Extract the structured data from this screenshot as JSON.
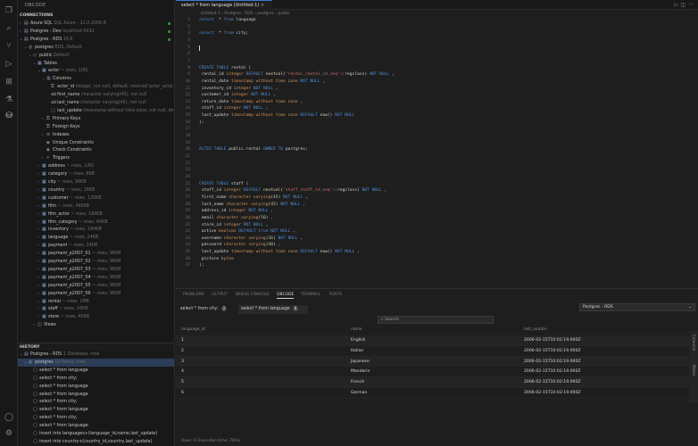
{
  "sidebar": {
    "header": "DBCODE",
    "connections_title": "CONNECTIONS",
    "tree": [
      {
        "chev": "›",
        "icon": "▤",
        "label": "Azure SQL",
        "dim": "SQL Azure - 12.0.2000.8",
        "level": 1,
        "dot": true
      },
      {
        "chev": "›",
        "icon": "▤",
        "label": "Postgres - Dev",
        "dim": "localhost:5432",
        "level": 1,
        "dot": true
      },
      {
        "chev": "⌄",
        "icon": "▤",
        "label": "Postgres - RDS",
        "dim": "16.6",
        "level": 1,
        "dot": true
      },
      {
        "chev": "⌄",
        "icon": "◎",
        "label": "postgres",
        "dim": "RDS, Default",
        "level": 2
      },
      {
        "chev": "⌄",
        "icon": "◇",
        "label": "public",
        "dim": "Default",
        "level": 3
      },
      {
        "chev": "⌄",
        "icon": "▦",
        "label": "Tables",
        "dim": "",
        "level": 4
      },
      {
        "chev": "⌄",
        "icon": "▦",
        "label": "actor",
        "dim": "~ rows, 1/6S",
        "level": 5
      },
      {
        "chev": "⌄",
        "icon": "▥",
        "label": "Columns",
        "dim": "",
        "level": 6
      },
      {
        "chev": "",
        "icon": "⚿",
        "label": "actor_id",
        "dim": "integer, not null, default: nextval('actor_actor_id_seq'::regclass)",
        "level": 7
      },
      {
        "chev": "",
        "icon": "ab",
        "label": "first_name",
        "dim": "character varying(45), not null",
        "level": 7
      },
      {
        "chev": "",
        "icon": "ab",
        "label": "last_name",
        "dim": "character varying(45), not null",
        "level": 7
      },
      {
        "chev": "",
        "icon": "▢",
        "label": "last_update",
        "dim": "timestamp without time zone, not null, default: now()",
        "level": 7
      },
      {
        "chev": "›",
        "icon": "⚿",
        "label": "Primary Keys",
        "dim": "",
        "level": 6
      },
      {
        "chev": "",
        "icon": "⚿",
        "label": "Foreign Keys",
        "dim": "",
        "level": 6
      },
      {
        "chev": "›",
        "icon": "≡",
        "label": "Indexes",
        "dim": "",
        "level": 6
      },
      {
        "chev": "",
        "icon": "◈",
        "label": "Unique Constraints",
        "dim": "",
        "level": 6
      },
      {
        "chev": "",
        "icon": "◈",
        "label": "Check Constraints",
        "dim": "",
        "level": 6
      },
      {
        "chev": "›",
        "icon": "⚡",
        "label": "Triggers",
        "dim": "",
        "level": 6
      },
      {
        "chev": "›",
        "icon": "▦",
        "label": "address",
        "dim": "~ rows, 1/6S",
        "level": 5
      },
      {
        "chev": "›",
        "icon": "▦",
        "label": "category",
        "dim": "~ rows, 8KB",
        "level": 5
      },
      {
        "chev": "›",
        "icon": "▦",
        "label": "city",
        "dim": "~ rows, 96KB",
        "level": 5
      },
      {
        "chev": "›",
        "icon": "▦",
        "label": "country",
        "dim": "~ rows, 16KB",
        "level": 5
      },
      {
        "chev": "›",
        "icon": "▦",
        "label": "customer",
        "dim": "~ rows, 120KB",
        "level": 5
      },
      {
        "chev": "›",
        "icon": "▦",
        "label": "film",
        "dim": "~ rows, 496KB",
        "level": 5
      },
      {
        "chev": "›",
        "icon": "▦",
        "label": "film_actor",
        "dim": "~ rows, 184KB",
        "level": 5
      },
      {
        "chev": "›",
        "icon": "▦",
        "label": "film_category",
        "dim": "~ rows, 64KB",
        "level": 5
      },
      {
        "chev": "›",
        "icon": "▦",
        "label": "inventory",
        "dim": "~ rows, 184KB",
        "level": 5
      },
      {
        "chev": "›",
        "icon": "▦",
        "label": "language",
        "dim": "~ rows, 24KB",
        "level": 5
      },
      {
        "chev": "›",
        "icon": "▦",
        "label": "payment",
        "dim": "~ rows, 24KB",
        "level": 5
      },
      {
        "chev": "›",
        "icon": "▦",
        "label": "payment_p2007_01",
        "dim": "~ rows, 96KB",
        "level": 5
      },
      {
        "chev": "›",
        "icon": "▦",
        "label": "payment_p2007_02",
        "dim": "~ rows, 96KB",
        "level": 5
      },
      {
        "chev": "›",
        "icon": "▦",
        "label": "payment_p2007_03",
        "dim": "~ rows, 96KB",
        "level": 5
      },
      {
        "chev": "›",
        "icon": "▦",
        "label": "payment_p2007_04",
        "dim": "~ rows, 96KB",
        "level": 5
      },
      {
        "chev": "›",
        "icon": "▦",
        "label": "payment_p2007_05",
        "dim": "~ rows, 96KB",
        "level": 5
      },
      {
        "chev": "›",
        "icon": "▦",
        "label": "payment_p2007_06",
        "dim": "~ rows, 96KB",
        "level": 5
      },
      {
        "chev": "›",
        "icon": "▦",
        "label": "rental",
        "dim": "~ rows, 1MB",
        "level": 5
      },
      {
        "chev": "›",
        "icon": "▦",
        "label": "staff",
        "dim": "~ rows, 16KB",
        "level": 5
      },
      {
        "chev": "›",
        "icon": "▦",
        "label": "store",
        "dim": "~ rows, 40KB",
        "level": 5
      },
      {
        "chev": "›",
        "icon": "◫",
        "label": "Views",
        "dim": "",
        "level": 4
      }
    ],
    "history_title": "HISTORY",
    "history": [
      {
        "chev": "⌄",
        "icon": "▤",
        "label": "Postgres - RDS",
        "dim": "1 Database, now",
        "level": 1
      },
      {
        "chev": "⌄",
        "icon": "◎",
        "label": "postgres",
        "dim": "10 items, now",
        "level": 2,
        "sel": true
      },
      {
        "chev": "",
        "icon": "▢",
        "label": "select * from language",
        "dim": "",
        "level": 3
      },
      {
        "chev": "",
        "icon": "▢",
        "label": "select * from city;",
        "dim": "",
        "level": 3
      },
      {
        "chev": "",
        "icon": "▢",
        "label": "select * from language",
        "dim": "",
        "level": 3
      },
      {
        "chev": "",
        "icon": "▢",
        "label": "select * from language",
        "dim": "",
        "level": 3
      },
      {
        "chev": "",
        "icon": "▢",
        "label": "select * from city;",
        "dim": "",
        "level": 3
      },
      {
        "chev": "",
        "icon": "▢",
        "label": "select * from language",
        "dim": "",
        "level": 3
      },
      {
        "chev": "",
        "icon": "▢",
        "label": "select * from city;",
        "dim": "",
        "level": 3
      },
      {
        "chev": "",
        "icon": "▢",
        "label": "select * from language",
        "dim": "",
        "level": 3
      },
      {
        "chev": "",
        "icon": "▢",
        "label": "insert into languages+(language_id,name,last_update)",
        "dim": "",
        "level": 3
      },
      {
        "chev": "",
        "icon": "▢",
        "label": "insert into country+(country_id,country,last_update)",
        "dim": "",
        "level": 3
      }
    ]
  },
  "editor": {
    "tab_label": "select * from language (Untitled-1)",
    "breadcrumb": "Untitled-1 › Postgres - RDS › postgres › public",
    "lines": [
      [
        [
          "k",
          "select"
        ],
        [
          "",
          "  * "
        ],
        [
          "k",
          "from"
        ],
        [
          "",
          " language"
        ]
      ],
      [],
      [
        [
          "k",
          "select"
        ],
        [
          "",
          "  * "
        ],
        [
          "k",
          "from"
        ],
        [
          "",
          " city;"
        ]
      ],
      [],
      [],
      [],
      [],
      [
        [
          "k",
          "CREATE TABLE"
        ],
        [
          "",
          " rental ("
        ]
      ],
      [
        [
          "",
          " rental_id "
        ],
        [
          "t",
          "integer"
        ],
        [
          "k",
          " DEFAULT "
        ],
        [
          "f",
          "nextval"
        ],
        [
          "",
          "("
        ],
        [
          "s",
          "'rental_rental_id_seq'"
        ],
        [
          "",
          "::regclass) "
        ],
        [
          "k",
          "NOT NULL"
        ],
        [
          "",
          " ,"
        ]
      ],
      [
        [
          "",
          " rental_date "
        ],
        [
          "t",
          "timestamp without time zone"
        ],
        [
          "k",
          " NOT NULL"
        ],
        [
          "",
          " ,"
        ]
      ],
      [
        [
          "",
          " inventory_id "
        ],
        [
          "t",
          "integer"
        ],
        [
          "k",
          " NOT NULL"
        ],
        [
          "",
          " ,"
        ]
      ],
      [
        [
          "",
          " customer_id "
        ],
        [
          "t",
          "integer"
        ],
        [
          "k",
          " NOT NULL"
        ],
        [
          "",
          " ,"
        ]
      ],
      [
        [
          "",
          " return_date "
        ],
        [
          "t",
          "timestamp without time zone"
        ],
        [
          "",
          " ,"
        ]
      ],
      [
        [
          "",
          " staff_id "
        ],
        [
          "t",
          "integer"
        ],
        [
          "k",
          " NOT NULL"
        ],
        [
          "",
          " ,"
        ]
      ],
      [
        [
          "",
          " last_update "
        ],
        [
          "t",
          "timestamp without time zone"
        ],
        [
          "k",
          " DEFAULT "
        ],
        [
          "f",
          "now"
        ],
        [
          "",
          "() "
        ],
        [
          "k",
          "NOT NULL"
        ]
      ],
      [
        [
          "",
          ");"
        ]
      ],
      [],
      [],
      [],
      [
        [
          "k",
          "ALTER TABLE"
        ],
        [
          "",
          " public.rental "
        ],
        [
          "k",
          "OWNER TO"
        ],
        [
          "",
          " postgres;"
        ]
      ],
      [],
      [],
      [],
      [],
      [
        [
          "k",
          "CREATE TABLE"
        ],
        [
          "",
          " staff ("
        ]
      ],
      [
        [
          "",
          " staff_id "
        ],
        [
          "t",
          "integer"
        ],
        [
          "k",
          " DEFAULT "
        ],
        [
          "f",
          "nextval"
        ],
        [
          "",
          "("
        ],
        [
          "s",
          "'staff_staff_id_seq'"
        ],
        [
          "",
          "::regclass) "
        ],
        [
          "k",
          "NOT NULL"
        ],
        [
          "",
          " ,"
        ]
      ],
      [
        [
          "",
          " first_name "
        ],
        [
          "t",
          "character varying"
        ],
        [
          "",
          "("
        ],
        [
          "n",
          "45"
        ],
        [
          "",
          ") "
        ],
        [
          "k",
          "NOT NULL"
        ],
        [
          "",
          " ,"
        ]
      ],
      [
        [
          "",
          " last_name "
        ],
        [
          "t",
          "character varying"
        ],
        [
          "",
          "("
        ],
        [
          "n",
          "45"
        ],
        [
          "",
          ") "
        ],
        [
          "k",
          "NOT NULL"
        ],
        [
          "",
          " ,"
        ]
      ],
      [
        [
          "",
          " address_id "
        ],
        [
          "t",
          "integer"
        ],
        [
          "k",
          " NOT NULL"
        ],
        [
          "",
          " ,"
        ]
      ],
      [
        [
          "",
          " email "
        ],
        [
          "t",
          "character varying"
        ],
        [
          "",
          "("
        ],
        [
          "n",
          "50"
        ],
        [
          "",
          ") ,"
        ]
      ],
      [
        [
          "",
          " store_id "
        ],
        [
          "t",
          "integer"
        ],
        [
          "k",
          " NOT NULL"
        ],
        [
          "",
          " ,"
        ]
      ],
      [
        [
          "",
          " active "
        ],
        [
          "t",
          "boolean"
        ],
        [
          "k",
          " DEFAULT true NOT NULL"
        ],
        [
          "",
          " ,"
        ]
      ],
      [
        [
          "",
          " username "
        ],
        [
          "t",
          "character varying"
        ],
        [
          "",
          "("
        ],
        [
          "n",
          "16"
        ],
        [
          "",
          ") "
        ],
        [
          "k",
          "NOT NULL"
        ],
        [
          "",
          " ,"
        ]
      ],
      [
        [
          "",
          " password "
        ],
        [
          "t",
          "character varying"
        ],
        [
          "",
          "("
        ],
        [
          "n",
          "40"
        ],
        [
          "",
          ") ,"
        ]
      ],
      [
        [
          "",
          " last_update "
        ],
        [
          "t",
          "timestamp without time zone"
        ],
        [
          "k",
          " DEFAULT "
        ],
        [
          "f",
          "now"
        ],
        [
          "",
          "() "
        ],
        [
          "k",
          "NOT NULL"
        ],
        [
          "",
          " ,"
        ]
      ],
      [
        [
          "",
          " picture "
        ],
        [
          "t",
          "bytea"
        ]
      ],
      [
        [
          "",
          ");"
        ]
      ]
    ]
  },
  "panel": {
    "tabs": [
      "PROBLEMS",
      "OUTPUT",
      "DEBUG CONSOLE",
      "DBCODE",
      "TERMINAL",
      "PORTS"
    ],
    "active_tab": "DBCODE",
    "query_tabs": [
      {
        "label": "select * from city;",
        "count": "2"
      },
      {
        "label": "select * from language",
        "count": "6"
      }
    ],
    "connection": "Postgres - RDS",
    "search_placeholder": "Search",
    "columns": [
      "language_id",
      "name",
      "last_update"
    ],
    "rows": [
      [
        "1",
        "English",
        "2006-02-15T10:02:19.000Z"
      ],
      [
        "2",
        "Italian",
        "2006-02-15T10:02:19.000Z"
      ],
      [
        "3",
        "Japanese",
        "2006-02-15T10:02:19.000Z"
      ],
      [
        "4",
        "Mandarin",
        "2006-02-15T10:02:19.000Z"
      ],
      [
        "5",
        "French",
        "2006-02-15T10:02:19.000Z"
      ],
      [
        "6",
        "German",
        "2006-02-15T10:02:19.000Z"
      ]
    ],
    "side_labels": [
      "Columns",
      "Filters"
    ],
    "status": "Rows: 6   Execution time: 78ms"
  }
}
